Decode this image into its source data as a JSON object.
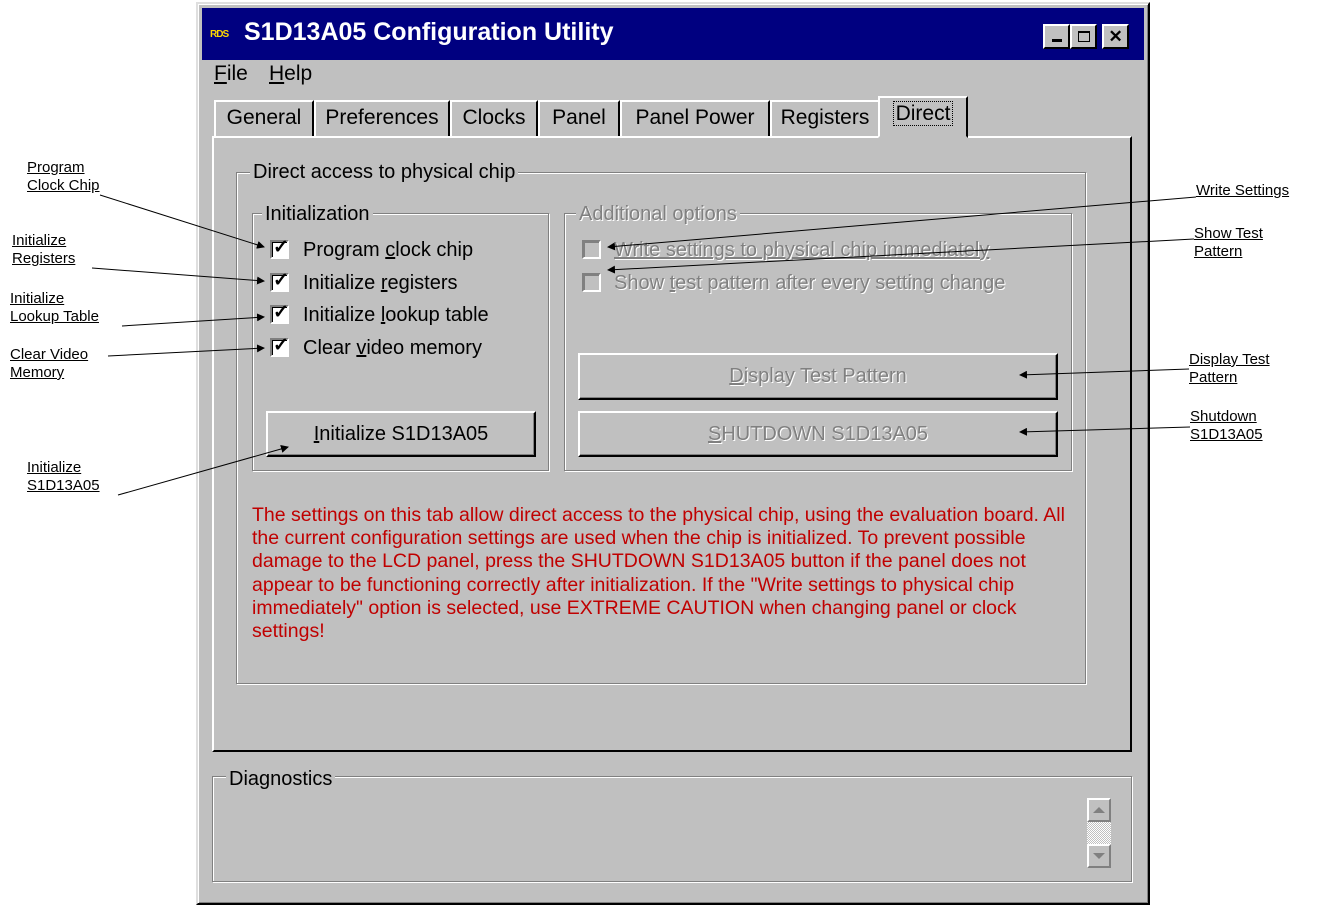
{
  "window": {
    "title": "S1D13A05 Configuration Utility",
    "icon": "app-logo-icon",
    "icon_text": "RDS",
    "controls": [
      "minimize-icon",
      "maximize-icon",
      "close-icon"
    ]
  },
  "menu": {
    "file": {
      "accel": "F",
      "rest": "ile"
    },
    "help": {
      "accel": "H",
      "rest": "elp"
    }
  },
  "tabs": [
    {
      "label": "General",
      "active": false
    },
    {
      "label": "Preferences",
      "active": false
    },
    {
      "label": "Clocks",
      "active": false
    },
    {
      "label": "Panel",
      "active": false
    },
    {
      "label": "Panel Power",
      "active": false
    },
    {
      "label": "Registers",
      "active": false
    },
    {
      "label": "Direct",
      "active": true
    }
  ],
  "direct": {
    "group_label": "Direct access to physical chip",
    "initialization": {
      "label": "Initialization",
      "options": [
        {
          "pre": "Program ",
          "accel": "c",
          "post": "lock chip",
          "checked": true
        },
        {
          "pre": "Initialize ",
          "accel": "r",
          "post": "egisters",
          "checked": true
        },
        {
          "pre": "Initialize ",
          "accel": "l",
          "post": "ookup table",
          "checked": true
        },
        {
          "pre": "Clear ",
          "accel": "v",
          "post": "ideo memory",
          "checked": true
        }
      ],
      "button": {
        "accel": "I",
        "rest": "nitialize S1D13A05"
      }
    },
    "additional": {
      "label": "Additional options",
      "enabled": false,
      "options": [
        {
          "accel": "W",
          "rest": "rite settings to physical chip immediately",
          "checked": false
        },
        {
          "pre": "Show ",
          "accel": "t",
          "post": "est pattern after every setting change",
          "checked": false
        }
      ],
      "display_button": {
        "accel": "D",
        "rest": "isplay Test Pattern"
      },
      "shutdown_button": {
        "accel": "S",
        "rest": "HUTDOWN S1D13A05"
      }
    },
    "notice": "The settings on this tab allow direct access to the physical chip, using the evaluation board.  All the current configuration settings are used when the chip is initialized.  To prevent possible damage to the LCD panel, press the SHUTDOWN S1D13A05 button if the panel does not appear to be functioning correctly after initialization.  If the \"Write settings to physical chip immediately\" option is selected, use EXTREME CAUTION when changing panel or clock settings!",
    "notice_color": "#c00000"
  },
  "diagnostics": {
    "label": "Diagnostics",
    "scroll_up_icon": "scroll-up-arrow-icon",
    "scroll_down_icon": "scroll-down-arrow-icon"
  },
  "annotations": {
    "program_clock_chip": [
      "Program",
      "Clock Chip"
    ],
    "initialize_registers": [
      "Initialize",
      "Registers"
    ],
    "initialize_lookup_table": [
      "Initialize",
      "Lookup Table"
    ],
    "clear_video_memory": [
      "Clear Video",
      "Memory"
    ],
    "initialize_s1d13a05": [
      "Initialize",
      "S1D13A05"
    ],
    "write_settings": [
      "Write Settings"
    ],
    "show_test_pattern": [
      "Show Test",
      "Pattern"
    ],
    "display_test_pattern": [
      "Display Test",
      "Pattern"
    ],
    "shutdown_s1d13a05": [
      "Shutdown",
      "S1D13A05"
    ]
  }
}
